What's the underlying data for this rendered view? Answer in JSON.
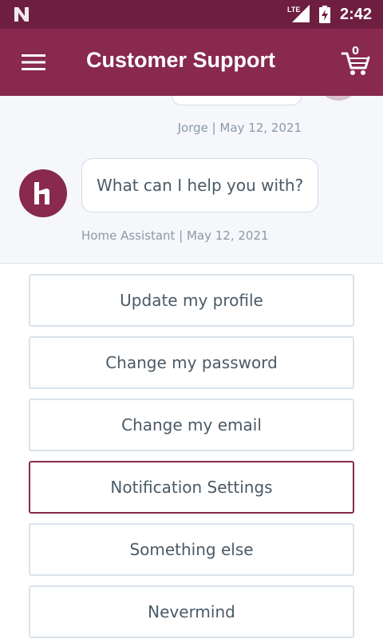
{
  "status_bar": {
    "time": "2:42",
    "network_label": "LTE",
    "icons": [
      "n-logo-icon",
      "signal-icon",
      "battery-charging-icon"
    ]
  },
  "header": {
    "title": "Customer Support",
    "cart_count": "0",
    "icons": [
      "menu-icon",
      "cart-icon"
    ],
    "background": "#88294d"
  },
  "chat": {
    "messages": [
      {
        "sender": "Jorge",
        "date": "May 12, 2021",
        "meta": "Jorge | May 12, 2021"
      },
      {
        "sender": "Home Assistant",
        "date": "May 12, 2021",
        "text": "What can I help you with?",
        "meta": "Home Assistant | May 12, 2021"
      }
    ]
  },
  "options": [
    {
      "label": "Update my profile"
    },
    {
      "label": "Change my password"
    },
    {
      "label": "Change my email"
    },
    {
      "label": "Notification Settings",
      "selected": true
    },
    {
      "label": "Something else"
    },
    {
      "label": "Nevermind"
    }
  ],
  "colors": {
    "brand": "#88294d",
    "status_bar": "#6e1f40",
    "text": "#4a5a66",
    "meta_text": "#8a9aa8",
    "border": "#dbe3ea"
  }
}
